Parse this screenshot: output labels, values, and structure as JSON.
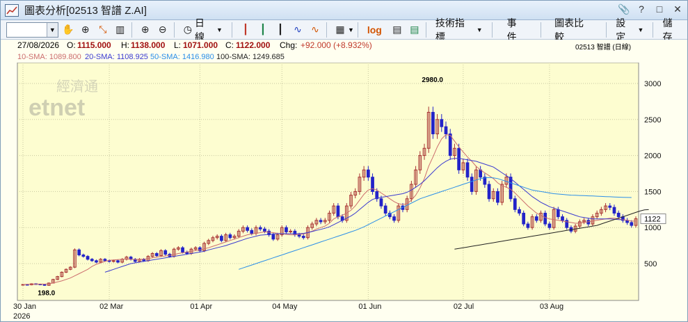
{
  "window": {
    "title": "圖表分析[02513 智譜 Z.AI]"
  },
  "toolbar": {
    "period_label": "日線",
    "log_label": "log",
    "indicators_label": "技術指標",
    "events_label": "事件",
    "compare_label": "圖表比較",
    "settings_label": "設定",
    "save_label": "儲存"
  },
  "quote": {
    "date": "27/08/2026",
    "open_label": "O:",
    "open": "1115.000",
    "high_label": "H:",
    "high": "1138.000",
    "low_label": "L:",
    "low": "1071.000",
    "close_label": "C:",
    "close": "1122.000",
    "chg_label": "Chg:",
    "chg": "+92.000 (+8.932%)",
    "symbol": "02513  智譜 (日線)"
  },
  "sma": [
    {
      "label": "10-SMA:",
      "value": "1089.800",
      "color": "#cc6d6d"
    },
    {
      "label": "20-SMA:",
      "value": "1108.925",
      "color": "#3a3ad0"
    },
    {
      "label": "50-SMA:",
      "value": "1416.980",
      "color": "#2a8ee8"
    },
    {
      "label": "100-SMA:",
      "value": "1249.685",
      "color": "#222222"
    }
  ],
  "watermark": {
    "line1": "經濟通",
    "line2": "etnet"
  },
  "colors": {
    "up": "#a83232",
    "down": "#2323c8",
    "background": "#fdfdd0",
    "grid": "#c8c8a0"
  },
  "chart_data": {
    "type": "candlestick",
    "y_ticks": [
      "500",
      "1000",
      "1500",
      "2000",
      "2500",
      "3000"
    ],
    "ylim": [
      0,
      3200
    ],
    "x_labels": [
      {
        "text": "30 Jan",
        "idx": 0
      },
      {
        "text": "02 Mar",
        "idx": 20
      },
      {
        "text": "01 Apr",
        "idx": 41
      },
      {
        "text": "04 May",
        "idx": 60
      },
      {
        "text": "01 Jun",
        "idx": 80
      },
      {
        "text": "02 Jul",
        "idx": 102
      },
      {
        "text": "03 Aug",
        "idx": 122
      }
    ],
    "x_year": "2026",
    "last_price_label": "1122",
    "annotations": [
      {
        "text": "2980.0",
        "idx": 95,
        "value": 2980
      },
      {
        "text": "198.0",
        "idx": 6,
        "value": 198
      }
    ],
    "closes": [
      210,
      205,
      220,
      215,
      208,
      198,
      230,
      280,
      320,
      380,
      420,
      450,
      690,
      620,
      600,
      560,
      540,
      520,
      560,
      540,
      530,
      540,
      520,
      560,
      590,
      560,
      530,
      560,
      540,
      600,
      640,
      610,
      680,
      630,
      600,
      700,
      720,
      660,
      640,
      700,
      720,
      680,
      780,
      820,
      860,
      880,
      820,
      900,
      860,
      880,
      950,
      1000,
      960,
      920,
      1000,
      980,
      950,
      900,
      840,
      900,
      1000,
      940,
      950,
      900,
      880,
      860,
      1000,
      1050,
      1100,
      1080,
      1100,
      1200,
      1300,
      1150,
      1100,
      1300,
      1450,
      1500,
      1700,
      1800,
      1700,
      1500,
      1400,
      1300,
      1200,
      1150,
      1100,
      1300,
      1250,
      1400,
      1600,
      1800,
      2000,
      2100,
      2600,
      2300,
      2500,
      2400,
      2300,
      2000,
      2100,
      1800,
      1900,
      1700,
      1500,
      1800,
      1700,
      1600,
      1400,
      1500,
      1350,
      1600,
      1700,
      1400,
      1250,
      1200,
      1050,
      1000,
      1150,
      1100,
      1200,
      1050,
      1000,
      1250,
      1150,
      1100,
      1000,
      950,
      1020,
      1080,
      1100,
      1050,
      1150,
      1200,
      1250,
      1300,
      1280,
      1200,
      1150,
      1100,
      1070,
      1030,
      1122
    ],
    "sma10": [
      210,
      212,
      214,
      215,
      216,
      215,
      220,
      230,
      245,
      260,
      280,
      300,
      330,
      360,
      390,
      420,
      460,
      490,
      510,
      530,
      545,
      550,
      555,
      560,
      565,
      560,
      555,
      560,
      560,
      570,
      580,
      590,
      600,
      605,
      615,
      625,
      640,
      650,
      660,
      670,
      680,
      690,
      705,
      720,
      740,
      760,
      780,
      800,
      820,
      840,
      860,
      880,
      900,
      910,
      920,
      930,
      940,
      935,
      930,
      920,
      915,
      905,
      900,
      900,
      905,
      910,
      930,
      950,
      980,
      1000,
      1020,
      1060,
      1120,
      1150,
      1170,
      1200,
      1240,
      1300,
      1380,
      1460,
      1520,
      1540,
      1520,
      1480,
      1440,
      1400,
      1360,
      1330,
      1320,
      1330,
      1380,
      1450,
      1550,
      1680,
      1850,
      1980,
      2120,
      2230,
      2290,
      2280,
      2200,
      2120,
      2050,
      1980,
      1920,
      1850,
      1800,
      1760,
      1720,
      1680,
      1620,
      1580,
      1560,
      1530,
      1480,
      1420,
      1360,
      1300,
      1250,
      1200,
      1170,
      1140,
      1120,
      1110,
      1100,
      1090,
      1080,
      1070,
      1060,
      1060,
      1070,
      1080,
      1090,
      1100,
      1110,
      1120,
      1130,
      1130,
      1120,
      1110,
      1100,
      1090,
      1090
    ],
    "sma20": [
      null,
      null,
      null,
      null,
      null,
      null,
      null,
      null,
      null,
      null,
      null,
      null,
      null,
      null,
      null,
      null,
      null,
      null,
      null,
      380,
      400,
      420,
      440,
      460,
      480,
      500,
      510,
      520,
      530,
      540,
      550,
      560,
      570,
      580,
      590,
      600,
      610,
      620,
      630,
      640,
      650,
      660,
      670,
      690,
      705,
      720,
      735,
      750,
      770,
      790,
      810,
      830,
      850,
      865,
      880,
      895,
      900,
      905,
      910,
      915,
      915,
      915,
      915,
      915,
      915,
      920,
      930,
      945,
      960,
      975,
      990,
      1010,
      1040,
      1070,
      1100,
      1130,
      1160,
      1200,
      1250,
      1300,
      1350,
      1390,
      1410,
      1420,
      1430,
      1440,
      1450,
      1460,
      1470,
      1490,
      1520,
      1560,
      1600,
      1650,
      1710,
      1770,
      1830,
      1880,
      1920,
      1950,
      1960,
      1960,
      1950,
      1940,
      1930,
      1920,
      1900,
      1880,
      1860,
      1840,
      1800,
      1760,
      1720,
      1680,
      1630,
      1580,
      1530,
      1480,
      1430,
      1390,
      1350,
      1320,
      1290,
      1270,
      1250,
      1230,
      1210,
      1190,
      1170,
      1150,
      1140,
      1130,
      1120,
      1120,
      1120,
      1120,
      1120,
      1115,
      1110,
      1108
    ],
    "sma50": [
      null,
      null,
      null,
      null,
      null,
      null,
      null,
      null,
      null,
      null,
      null,
      null,
      null,
      null,
      null,
      null,
      null,
      null,
      null,
      null,
      null,
      null,
      null,
      null,
      null,
      null,
      null,
      null,
      null,
      null,
      null,
      null,
      null,
      null,
      null,
      null,
      null,
      null,
      null,
      null,
      null,
      null,
      null,
      null,
      null,
      null,
      null,
      null,
      null,
      null,
      420,
      440,
      460,
      480,
      500,
      520,
      540,
      560,
      580,
      600,
      620,
      640,
      660,
      680,
      700,
      720,
      740,
      760,
      780,
      800,
      820,
      840,
      860,
      880,
      900,
      920,
      940,
      960,
      985,
      1010,
      1040,
      1070,
      1100,
      1130,
      1160,
      1190,
      1220,
      1250,
      1280,
      1310,
      1340,
      1370,
      1400,
      1420,
      1440,
      1460,
      1480,
      1500,
      1520,
      1540,
      1560,
      1580,
      1600,
      1620,
      1640,
      1660,
      1680,
      1690,
      1695,
      1690,
      1680,
      1660,
      1640,
      1620,
      1600,
      1580,
      1560,
      1540,
      1520,
      1510,
      1500,
      1490,
      1480,
      1470,
      1465,
      1460,
      1455,
      1450,
      1448,
      1445,
      1443,
      1440,
      1438,
      1435,
      1432,
      1430,
      1428,
      1425,
      1422,
      1420,
      1418,
      1417
    ],
    "sma100": [
      null,
      null,
      null,
      null,
      null,
      null,
      null,
      null,
      null,
      null,
      null,
      null,
      null,
      null,
      null,
      null,
      null,
      null,
      null,
      null,
      null,
      null,
      null,
      null,
      null,
      null,
      null,
      null,
      null,
      null,
      null,
      null,
      null,
      null,
      null,
      null,
      null,
      null,
      null,
      null,
      null,
      null,
      null,
      null,
      null,
      null,
      null,
      null,
      null,
      null,
      null,
      null,
      null,
      null,
      null,
      null,
      null,
      null,
      null,
      null,
      null,
      null,
      null,
      null,
      null,
      null,
      null,
      null,
      null,
      null,
      null,
      null,
      null,
      null,
      null,
      null,
      null,
      null,
      null,
      null,
      null,
      null,
      null,
      null,
      null,
      null,
      null,
      null,
      null,
      null,
      null,
      null,
      null,
      null,
      null,
      null,
      null,
      null,
      null,
      null,
      700,
      710,
      720,
      730,
      740,
      750,
      760,
      770,
      780,
      790,
      800,
      810,
      820,
      830,
      840,
      850,
      860,
      870,
      880,
      890,
      900,
      910,
      920,
      930,
      940,
      950,
      960,
      970,
      980,
      990,
      1000,
      1010,
      1020,
      1030,
      1050,
      1070,
      1090,
      1110,
      1130,
      1150,
      1170,
      1190,
      1210,
      1230,
      1245,
      1249
    ]
  }
}
